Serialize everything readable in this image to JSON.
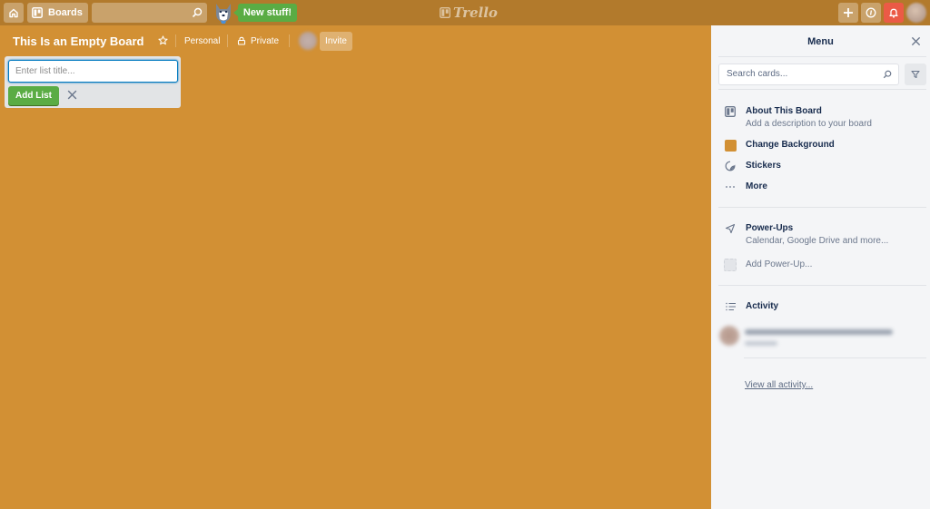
{
  "header": {
    "home_icon": "home-icon",
    "boards_label": "Boards",
    "search_placeholder": "",
    "new_stuff_label": "New stuff!",
    "logo_text": "Trello",
    "add_icon": "plus-icon",
    "info_icon": "info-icon",
    "notifications_icon": "bell-icon"
  },
  "board": {
    "title": "This Is an Empty Board",
    "team": "Personal",
    "visibility": "Private",
    "invite_label": "Invite",
    "background_color": "#d29034"
  },
  "composer": {
    "placeholder": "Enter list title...",
    "value": "",
    "add_label": "Add List"
  },
  "sidebar": {
    "title": "Menu",
    "search_placeholder": "Search cards...",
    "items": [
      {
        "label": "About This Board",
        "sub": "Add a description to your board",
        "icon": "board-icon"
      },
      {
        "label": "Change Background",
        "icon": "color-swatch"
      },
      {
        "label": "Stickers",
        "icon": "sticker-icon"
      },
      {
        "label": "More",
        "icon": "ellipsis-icon"
      },
      {
        "label": "Power-Ups",
        "sub": "Calendar, Google Drive and more...",
        "icon": "power-up-icon"
      },
      {
        "label": "Add Power-Up...",
        "icon": "add-power-up-placeholder"
      }
    ],
    "activity_title": "Activity",
    "view_all_label": "View all activity..."
  },
  "colors": {
    "header_bg": "#b27a2c",
    "board_bg": "#d29034",
    "green": "#5aac44",
    "bell_red": "#eb5a46",
    "sidebar_bg": "#f4f5f7"
  }
}
